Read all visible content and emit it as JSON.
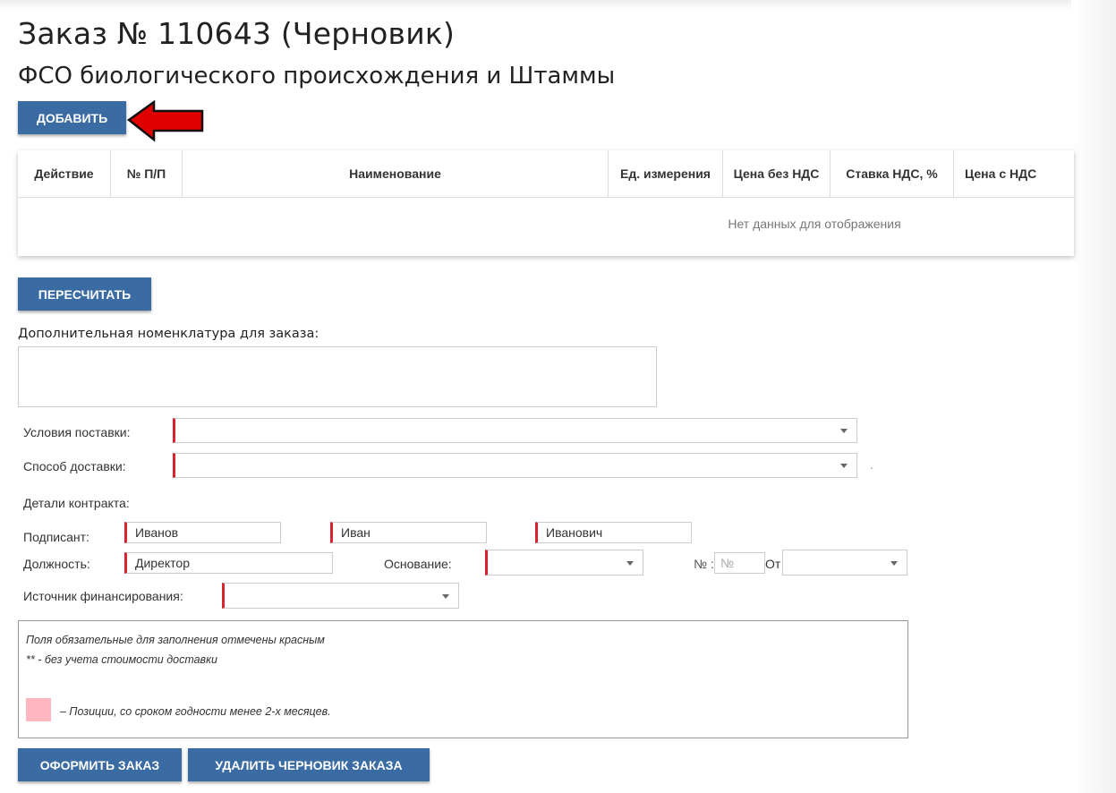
{
  "header": {
    "title": "Заказ № 110643 (Черновик)",
    "subtitle": "ФСО биологического происхождения и Штаммы"
  },
  "toolbar": {
    "add_label": "ДОБАВИТЬ"
  },
  "grid": {
    "columns": [
      "Действие",
      "№ П/П",
      "Наименование",
      "Ед. измерения",
      "Цена без НДС",
      "Ставка НДС, %",
      "Цена с НДС"
    ],
    "empty_text": "Нет данных для отображения"
  },
  "recalc_label": "ПЕРЕСЧИТАТЬ",
  "extra": {
    "label": "Дополнительная номенклатура для заказа:",
    "value": ""
  },
  "delivery": {
    "terms_label": "Условия поставки:",
    "terms_value": "",
    "method_label": "Способ доставки:",
    "method_value": "",
    "trailing_dot": "."
  },
  "contract": {
    "section_label": "Детали контракта:",
    "signer_label": "Подписант:",
    "last_name": "Иванов",
    "first_name": "Иван",
    "middle_name": "Иванович",
    "position_label": "Должность:",
    "position_value": "Директор",
    "basis_label": "Основание:",
    "basis_value": "",
    "number_label": "№ :",
    "number_placeholder": "№",
    "from_label": "От",
    "from_value": "",
    "funding_label": "Источник финансирования:",
    "funding_value": ""
  },
  "notes": {
    "required": "Поля обязательные для заполнения отмечены красным",
    "no_delivery": "** - без учета стоимости доставки",
    "expiry_legend": "– Позиции, со сроком годности менее 2-х месяцев."
  },
  "actions": {
    "submit_label": "ОФОРМИТЬ ЗАКАЗ",
    "delete_label": "УДАЛИТЬ ЧЕРНОВИК ЗАКАЗА"
  },
  "colors": {
    "primary_button": "#3a6ba3",
    "required_marker": "#d9232d",
    "expiry_swatch": "#ffb6c1",
    "arrow": "#e00000"
  }
}
